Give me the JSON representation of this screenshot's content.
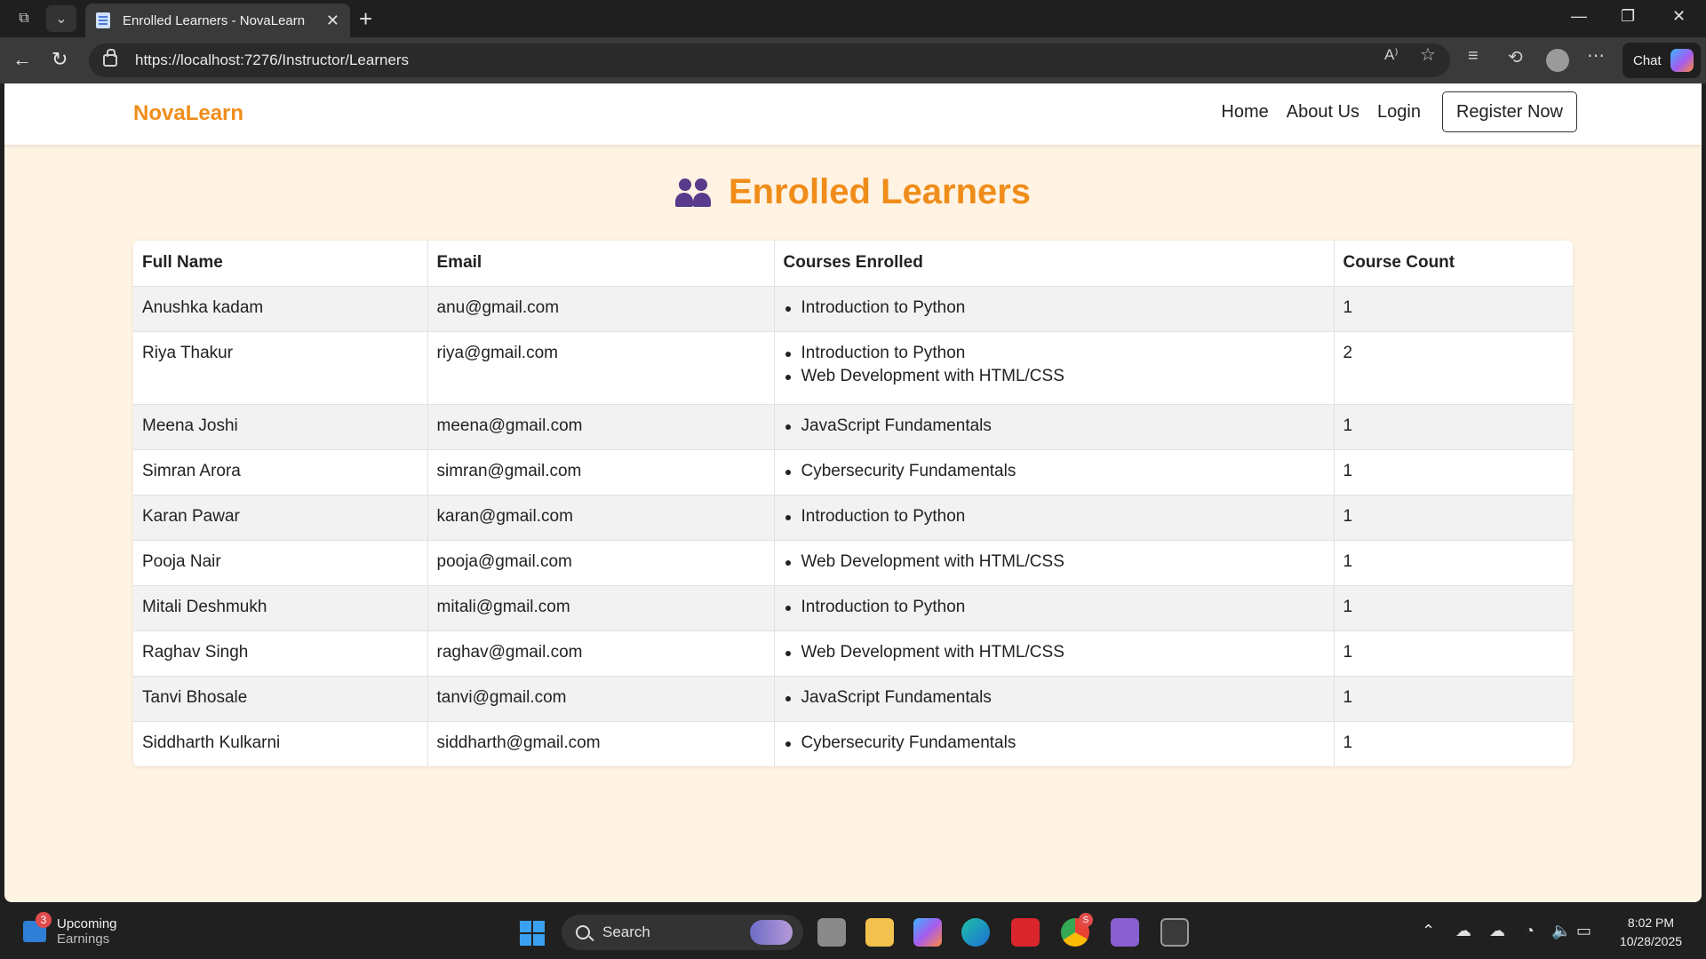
{
  "browser": {
    "tab_title": "Enrolled Learners - NovaLearn",
    "url": "https://localhost:7276/Instructor/Learners",
    "chat_label": "Chat"
  },
  "site": {
    "brand": "NovaLearn",
    "nav": {
      "home": "Home",
      "about": "About Us",
      "login": "Login",
      "register": "Register Now"
    }
  },
  "page": {
    "heading": "Enrolled Learners",
    "columns": [
      "Full Name",
      "Email",
      "Courses Enrolled",
      "Course Count"
    ],
    "rows": [
      {
        "name": "Anushka kadam",
        "email": "anu@gmail.com",
        "courses": [
          "Introduction to Python"
        ],
        "count": "1"
      },
      {
        "name": "Riya Thakur",
        "email": "riya@gmail.com",
        "courses": [
          "Introduction to Python",
          "Web Development with HTML/CSS"
        ],
        "count": "2"
      },
      {
        "name": "Meena Joshi",
        "email": "meena@gmail.com",
        "courses": [
          "JavaScript Fundamentals"
        ],
        "count": "1"
      },
      {
        "name": "Simran Arora",
        "email": "simran@gmail.com",
        "courses": [
          "Cybersecurity Fundamentals"
        ],
        "count": "1"
      },
      {
        "name": "Karan Pawar",
        "email": "karan@gmail.com",
        "courses": [
          "Introduction to Python"
        ],
        "count": "1"
      },
      {
        "name": "Pooja Nair",
        "email": "pooja@gmail.com",
        "courses": [
          "Web Development with HTML/CSS"
        ],
        "count": "1"
      },
      {
        "name": "Mitali Deshmukh",
        "email": "mitali@gmail.com",
        "courses": [
          "Introduction to Python"
        ],
        "count": "1"
      },
      {
        "name": "Raghav Singh",
        "email": "raghav@gmail.com",
        "courses": [
          "Web Development with HTML/CSS"
        ],
        "count": "1"
      },
      {
        "name": "Tanvi Bhosale",
        "email": "tanvi@gmail.com",
        "courses": [
          "JavaScript Fundamentals"
        ],
        "count": "1"
      },
      {
        "name": "Siddharth Kulkarni",
        "email": "siddharth@gmail.com",
        "courses": [
          "Cybersecurity Fundamentals"
        ],
        "count": "1"
      }
    ]
  },
  "taskbar": {
    "widget_title": "Upcoming",
    "widget_subtitle": "Earnings",
    "widget_badge": "3",
    "search_label": "Search",
    "chrome_badge": "S",
    "time": "8:02 PM",
    "date": "10/28/2025"
  },
  "colors": {
    "brand": "#f08d1a",
    "page_bg": "#fff3e3",
    "stripe": "#f2f2f2"
  }
}
